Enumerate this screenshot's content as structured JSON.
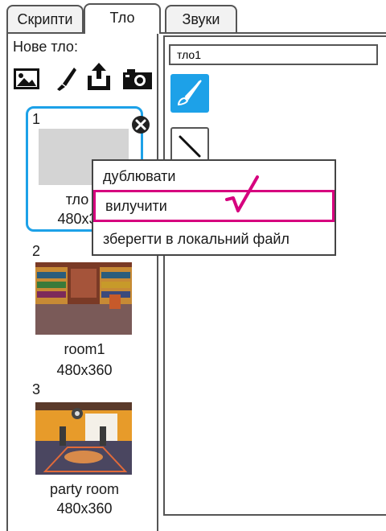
{
  "tabs": [
    {
      "label": "Скрипти"
    },
    {
      "label": "Тло"
    },
    {
      "label": "Звуки"
    }
  ],
  "left": {
    "new_backdrop_label": "Нове тло:",
    "tool_icons": [
      "image-library-icon",
      "paintbrush-icon",
      "upload-icon",
      "camera-icon"
    ],
    "backdrops": [
      {
        "index": "1",
        "name": "тло",
        "size": "480x3"
      },
      {
        "index": "2",
        "name": "room1",
        "size": "480x360"
      },
      {
        "index": "3",
        "name": "party room",
        "size": "480x360"
      }
    ]
  },
  "editor": {
    "name_value": "тло1"
  },
  "context_menu": {
    "items": [
      "дублювати",
      "вилучити",
      "зберегти в локальний файл"
    ],
    "highlighted_index": 1
  },
  "colors": {
    "accent_blue": "#1da1e8",
    "highlight_magenta": "#d6007e"
  }
}
